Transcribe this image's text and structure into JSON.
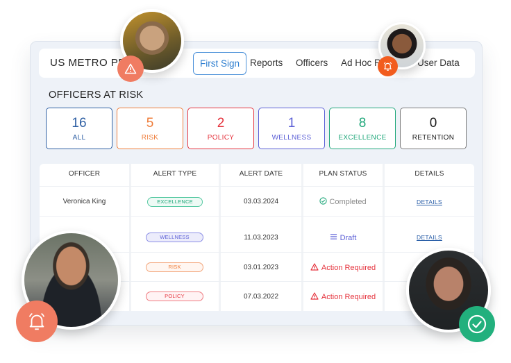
{
  "header": {
    "brand": "US METRO PD",
    "nav": [
      {
        "label": "First Sign",
        "active": true
      },
      {
        "label": "Reports",
        "active": false
      },
      {
        "label": "Officers",
        "active": false
      },
      {
        "label": "Ad Hoc Reports",
        "active": false
      },
      {
        "label": "User Data",
        "active": false
      }
    ]
  },
  "section_title": "OFFICERS AT RISK",
  "stats": [
    {
      "count": "16",
      "label": "ALL",
      "color": "#2e5fa3"
    },
    {
      "count": "5",
      "label": "RISK",
      "color": "#ef7d3a"
    },
    {
      "count": "2",
      "label": "POLICY",
      "color": "#e5333d"
    },
    {
      "count": "1",
      "label": "WELLNESS",
      "color": "#5b5fd6"
    },
    {
      "count": "8",
      "label": "EXCELLENCE",
      "color": "#1fa77a"
    },
    {
      "count": "0",
      "label": "RETENTION",
      "color": "#222222"
    }
  ],
  "table": {
    "columns": [
      "OFFICER",
      "ALERT TYPE",
      "ALERT DATE",
      "PLAN STATUS",
      "DETAILS"
    ],
    "rows": [
      {
        "officer": "Veronica King",
        "alert_type": "EXCELLENCE",
        "date": "03.03.2024",
        "status": "Completed",
        "status_icon": "check-circle-icon",
        "details": "DETAILS"
      },
      {
        "officer": "",
        "alert_type": "WELLNESS",
        "date": "11.03.2023",
        "status": "Draft",
        "status_icon": "list-icon",
        "details": "DETAILS"
      },
      {
        "officer": "",
        "alert_type": "RISK",
        "date": "03.01.2023",
        "status": "Action Required",
        "status_icon": "warning-icon",
        "details": ""
      },
      {
        "officer": "",
        "alert_type": "POLICY",
        "date": "07.03.2022",
        "status": "Action Required",
        "status_icon": "warning-icon",
        "details": ""
      }
    ]
  },
  "colors": {
    "excellence": "#1fa77a",
    "wellness": "#5b5fd6",
    "risk": "#ef7d3a",
    "policy": "#e5333d",
    "alert_badge": "#f07c62",
    "bell_badge_small": "#f25c1e",
    "success_badge": "#22b07d"
  },
  "avatars": [
    {
      "name": "older-man-officer-avatar",
      "badge": "warning-icon"
    },
    {
      "name": "woman-officer-avatar",
      "badge": "bell-icon"
    },
    {
      "name": "male-police-officer-avatar",
      "badge": "bell-icon"
    },
    {
      "name": "woman-glasses-officer-avatar",
      "badge": "check-circle-icon"
    }
  ]
}
